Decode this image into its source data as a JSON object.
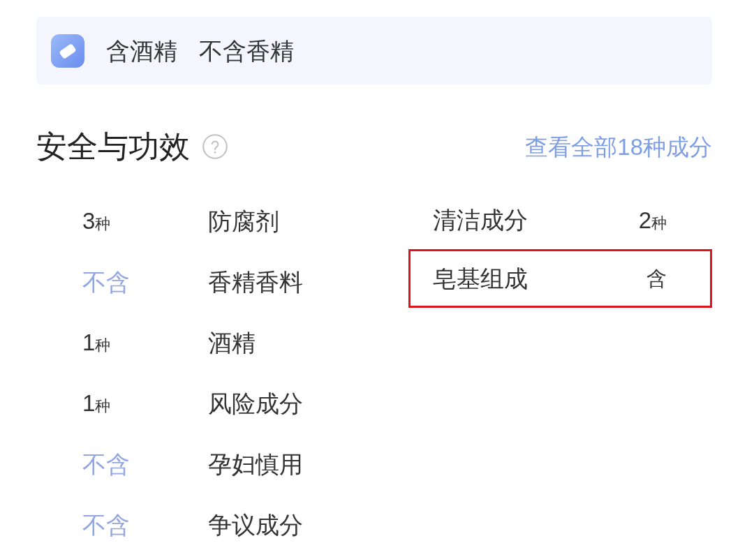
{
  "summary_banner": {
    "tags": [
      "含酒精",
      "不含香精"
    ]
  },
  "safety": {
    "title": "安全与功效",
    "link": "查看全部18种成分",
    "left_items": [
      {
        "kind": "count",
        "value": "3",
        "unit": "种",
        "label": "防腐剂"
      },
      {
        "kind": "absent",
        "value": "不含",
        "label": "香精香料"
      },
      {
        "kind": "count",
        "value": "1",
        "unit": "种",
        "label": "酒精"
      },
      {
        "kind": "count",
        "value": "1",
        "unit": "种",
        "label": "风险成分"
      },
      {
        "kind": "absent",
        "value": "不含",
        "label": "孕妇慎用"
      },
      {
        "kind": "absent",
        "value": "不含",
        "label": "争议成分"
      }
    ],
    "right_items": [
      {
        "kind": "count",
        "label": "清洁成分",
        "value": "2",
        "unit": "种",
        "highlighted": false
      },
      {
        "kind": "present",
        "label": "皂基组成",
        "value": "含",
        "highlighted": true
      }
    ]
  }
}
